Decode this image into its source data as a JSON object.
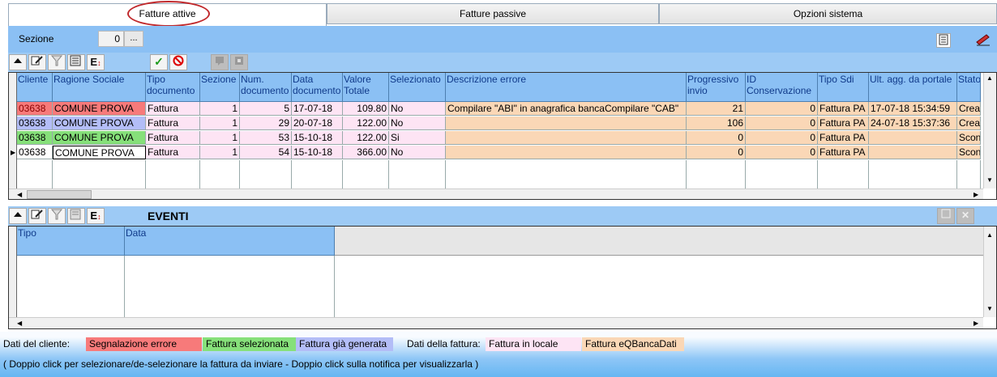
{
  "tabs": [
    {
      "label": "Fatture attive",
      "active": true
    },
    {
      "label": "Fatture passive",
      "active": false
    },
    {
      "label": "Opzioni sistema",
      "active": false
    }
  ],
  "sezione": {
    "label": "Sezione",
    "value": "0",
    "button": "..."
  },
  "invoices": {
    "columns": [
      {
        "label": "Cliente"
      },
      {
        "label": "Ragione Sociale"
      },
      {
        "label": "Tipo documento"
      },
      {
        "label": "Sezione"
      },
      {
        "label": "Num. documento"
      },
      {
        "label": "Data documento"
      },
      {
        "label": "Valore Totale"
      },
      {
        "label": "Selezionato"
      },
      {
        "label": "Descrizione errore"
      },
      {
        "label": "Progressivo invio"
      },
      {
        "label": "ID Conservazione"
      },
      {
        "label": "Tipo Sdi"
      },
      {
        "label": "Ult. agg. da portale"
      },
      {
        "label": "Stato"
      }
    ],
    "rows": [
      {
        "cliente": "03638",
        "ragione": "COMUNE PROVA",
        "tipo": "Fattura",
        "sezione": "1",
        "num": "5",
        "data": "17-07-18",
        "valore": "109.80",
        "selezionato": "No",
        "errore": "Compilare \"ABI\" in anagrafica bancaCompilare \"CAB\"",
        "progressivo": "21",
        "id_cons": "0",
        "tipo_sdi": "Fattura PA",
        "ult_agg": "17-07-18 15:34:59",
        "stato": "Creat",
        "status": "error"
      },
      {
        "cliente": "03638",
        "ragione": "COMUNE PROVA",
        "tipo": "Fattura",
        "sezione": "1",
        "num": "29",
        "data": "20-07-18",
        "valore": "122.00",
        "selezionato": "No",
        "errore": "",
        "progressivo": "106",
        "id_cons": "0",
        "tipo_sdi": "Fattura PA",
        "ult_agg": "24-07-18 15:37:36",
        "stato": "Creat",
        "status": "generated"
      },
      {
        "cliente": "03638",
        "ragione": "COMUNE PROVA",
        "tipo": "Fattura",
        "sezione": "1",
        "num": "53",
        "data": "15-10-18",
        "valore": "122.00",
        "selezionato": "Si",
        "errore": "",
        "progressivo": "0",
        "id_cons": "0",
        "tipo_sdi": "Fattura PA",
        "ult_agg": "",
        "stato": "Scon",
        "status": "selected"
      },
      {
        "cliente": "03638",
        "ragione": "COMUNE PROVA",
        "tipo": "Fattura",
        "sezione": "1",
        "num": "54",
        "data": "15-10-18",
        "valore": "366.00",
        "selezionato": "No",
        "errore": "",
        "progressivo": "0",
        "id_cons": "0",
        "tipo_sdi": "Fattura PA",
        "ult_agg": "",
        "stato": "Scon",
        "status": "current"
      }
    ]
  },
  "eventi": {
    "title": "EVENTI",
    "columns": [
      {
        "label": "Tipo"
      },
      {
        "label": "Data"
      }
    ]
  },
  "legend": {
    "dati_cliente": "Dati del cliente:",
    "segnalazione": "Segnalazione errore",
    "selezionata": "Fattura selezionata",
    "generata": "Fattura già generata",
    "dati_fattura": "Dati della fattura:",
    "locale": "Fattura in locale",
    "eqbanca": "Fattura eQBancaDati"
  },
  "footer_hint": "( Doppio click per selezionare/de-selezionare la fattura da inviare - Doppio click sulla notifica per visualizzarla )",
  "colors": {
    "header_blue": "#8bc0f4",
    "error": "#f77a7a",
    "selected": "#86e07a",
    "generated": "#b3bdf7",
    "local": "#fde4f4",
    "eqbanca": "#fad7b6"
  }
}
